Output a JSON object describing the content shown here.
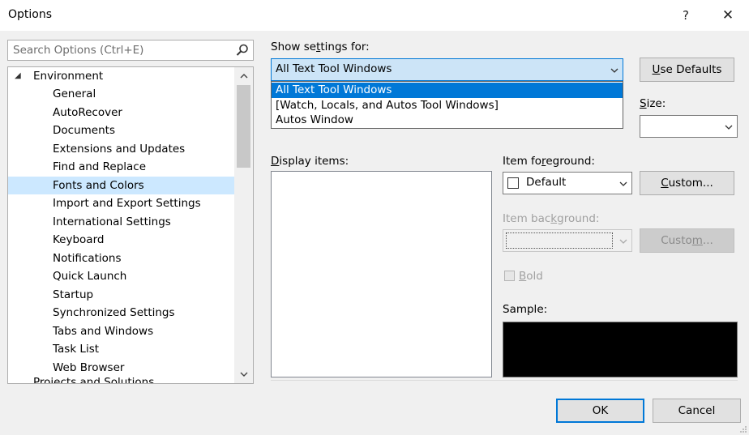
{
  "window": {
    "title": "Options",
    "help_glyph": "?",
    "close_glyph": "✕"
  },
  "search": {
    "placeholder": "Search Options (Ctrl+E)"
  },
  "tree": {
    "parent_label": "Environment",
    "children": [
      "General",
      "AutoRecover",
      "Documents",
      "Extensions and Updates",
      "Find and Replace",
      "Fonts and Colors",
      "Import and Export Settings",
      "International Settings",
      "Keyboard",
      "Notifications",
      "Quick Launch",
      "Startup",
      "Synchronized Settings",
      "Tabs and Windows",
      "Task List",
      "Web Browser"
    ],
    "selected": "Fonts and Colors",
    "partial_next": "Projects and Solutions"
  },
  "show_settings": {
    "label_pre": "Show se",
    "label_key": "t",
    "label_post": "tings for:",
    "selected": "All Text Tool Windows",
    "options": [
      "All Text Tool Windows",
      "[Watch, Locals, and Autos Tool Windows]",
      "Autos Window"
    ]
  },
  "use_defaults": {
    "key": "U",
    "rest": "se Defaults"
  },
  "size": {
    "key": "S",
    "rest": "ize:",
    "value": ""
  },
  "display_items": {
    "key": "D",
    "rest": "isplay items:"
  },
  "item_foreground": {
    "label_pre": "Item fo",
    "label_key": "r",
    "label_post": "eground:",
    "value": "Default",
    "custom_key": "C",
    "custom_rest": "ustom..."
  },
  "item_background": {
    "label_pre": "Item bac",
    "label_key": "k",
    "label_post": "ground:",
    "value": "",
    "custom_pre": "Custo",
    "custom_key": "m",
    "custom_post": "..."
  },
  "bold": {
    "key": "B",
    "rest": "old",
    "checked": false
  },
  "sample_label": "Sample:",
  "buttons": {
    "ok": "OK",
    "cancel": "Cancel"
  },
  "colors": {
    "accent": "#0078d7",
    "selection": "#cce8ff",
    "sample_bg": "#000000"
  }
}
